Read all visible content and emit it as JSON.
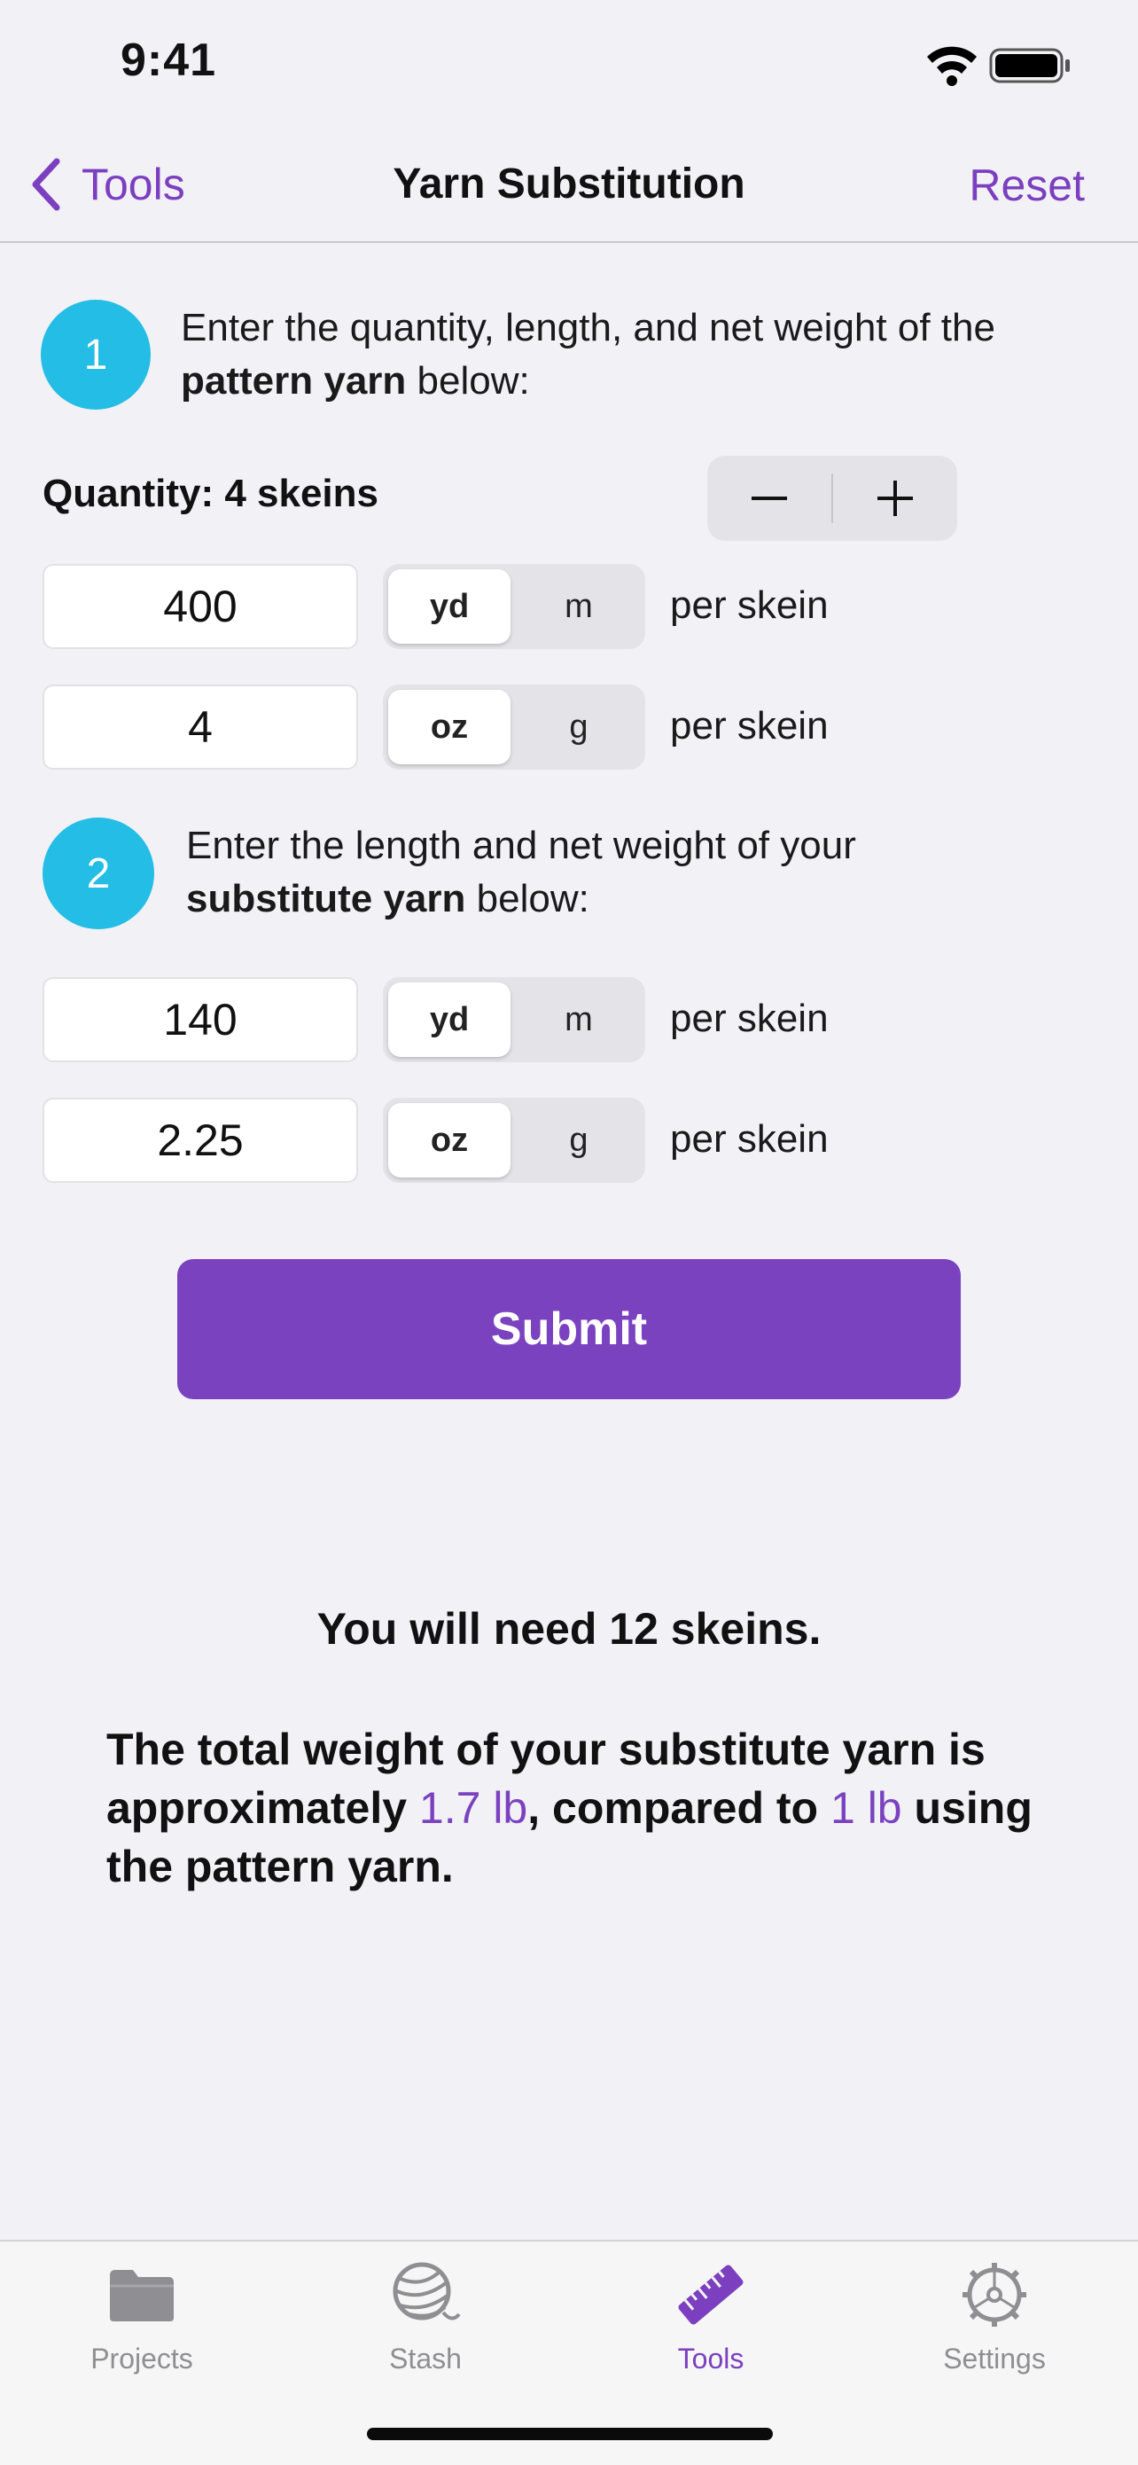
{
  "status": {
    "time": "9:41"
  },
  "nav": {
    "back_label": "Tools",
    "title": "Yarn Substitution",
    "reset_label": "Reset"
  },
  "step1": {
    "number": "1",
    "text_a": "Enter the quantity, length, and net weight of the",
    "text_bold": "pattern yarn",
    "text_b": "below:",
    "quantity_label": "Quantity: 4 skeins",
    "length_value": "400",
    "length_units": [
      "yd",
      "m"
    ],
    "length_selected": "yd",
    "weight_value": "4",
    "weight_units": [
      "oz",
      "g"
    ],
    "weight_selected": "oz",
    "per_label": "per skein"
  },
  "step2": {
    "number": "2",
    "text_a": "Enter the length and net weight of your",
    "text_bold": "substitute yarn",
    "text_b": "below:",
    "length_value": "140",
    "length_units": [
      "yd",
      "m"
    ],
    "length_selected": "yd",
    "weight_value": "2.25",
    "weight_units": [
      "oz",
      "g"
    ],
    "weight_selected": "oz",
    "per_label": "per skein"
  },
  "submit_label": "Submit",
  "result": {
    "skeins_needed": "You will need 12 skeins.",
    "weight_a": "The total weight of your substitute yarn is approximately",
    "substitute_weight": "1.7 lb",
    "weight_b": ", compared to",
    "pattern_weight": "1 lb",
    "weight_c": "using the pattern yarn."
  },
  "tabs": [
    {
      "label": "Projects",
      "icon": "folder-icon",
      "active": false
    },
    {
      "label": "Stash",
      "icon": "yarn-ball-icon",
      "active": false
    },
    {
      "label": "Tools",
      "icon": "ruler-icon",
      "active": true
    },
    {
      "label": "Settings",
      "icon": "gear-icon",
      "active": false
    }
  ],
  "colors": {
    "accent": "#7b42c0",
    "badge": "#24bde6",
    "background": "#f2f1f6"
  }
}
